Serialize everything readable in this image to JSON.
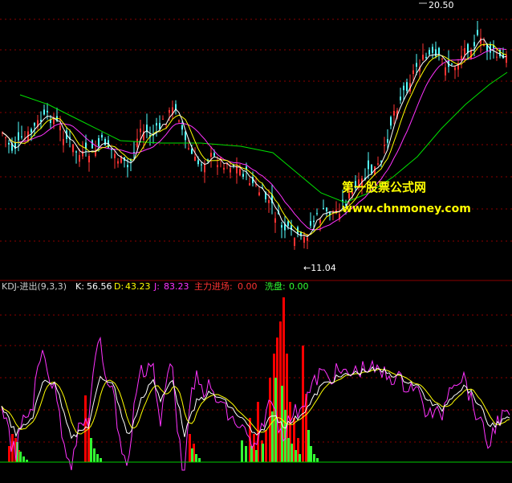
{
  "price_panel": {
    "high_label": "20.50",
    "low_label": "←11.04"
  },
  "watermark": {
    "line1": "第一股票公式网",
    "line2": "www.chnmoney.com",
    "color": "#ffff00"
  },
  "indicator_header": {
    "name": "KDJ-进出(9,3,3)",
    "k_label": "K:",
    "k_value": "56.56",
    "d_label": "D:",
    "d_value": "43.23",
    "j_label": "J:",
    "j_value": "83.23",
    "main_label": "主力进场:",
    "main_value": "0.00",
    "wash_label": "洗盘:",
    "wash_value": "0.00"
  },
  "colors": {
    "up_candle": "#ff3333",
    "down_candle": "#54ffff",
    "ma_white": "#ffffff",
    "ma_yellow": "#ffff00",
    "ma_magenta": "#ff33ff",
    "ma_green": "#00e000",
    "k_line": "#ffffff",
    "d_line": "#ffff00",
    "j_line": "#ff33ff",
    "main_bar": "#ff0000",
    "wash_bar": "#33ff33",
    "grid": "#8b0000"
  },
  "chart_data": {
    "type": "line",
    "price_axis": {
      "high": 20.5,
      "low": 11.04
    },
    "kdj": {
      "k": 56.56,
      "d": 43.23,
      "j": 83.23
    }
  }
}
